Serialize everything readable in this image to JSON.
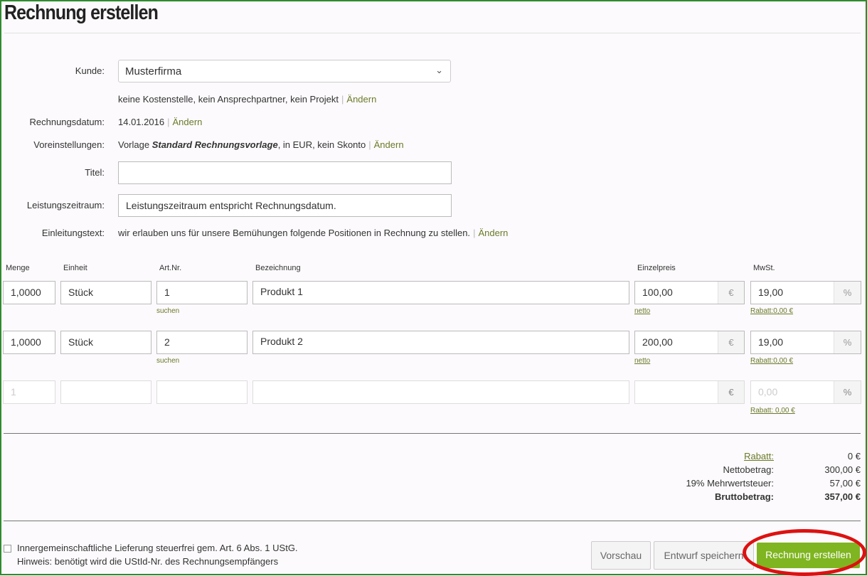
{
  "page": {
    "title": "Rechnung erstellen"
  },
  "form": {
    "kunde_label": "Kunde:",
    "kunde_value": "Musterfirma",
    "kunde_details": "keine Kostenstelle, kein Ansprechpartner, kein Projekt",
    "change_link": "Ändern",
    "datum_label": "Rechnungsdatum:",
    "datum_value": "14.01.2016",
    "voreinst_label": "Voreinstellungen:",
    "voreinst_prefix": "Vorlage ",
    "voreinst_template": "Standard Rechnungsvorlage",
    "voreinst_suffix": ", in EUR, kein Skonto",
    "titel_label": "Titel:",
    "titel_value": "",
    "leistung_label": "Leistungszeitraum:",
    "leistung_value": "Leistungszeitraum entspricht Rechnungsdatum.",
    "einleitung_label": "Einleitungstext:",
    "einleitung_value": "wir erlauben uns für unsere Bemühungen folgende Positionen in Rechnung zu stellen."
  },
  "table": {
    "headers": {
      "menge": "Menge",
      "einheit": "Einheit",
      "artnr": "Art.Nr.",
      "bezeichnung": "Bezeichnung",
      "einzelpreis": "Einzelpreis",
      "mwst": "MwSt."
    },
    "currency_symbol": "€",
    "percent_symbol": "%",
    "search_link": "suchen",
    "netto_link": "netto",
    "rows": [
      {
        "menge": "1,0000",
        "einheit": "Stück",
        "artnr": "1",
        "bezeichnung": "Produkt 1",
        "preis": "100,00",
        "mwst": "19,00",
        "rabatt": "Rabatt:0,00 €"
      },
      {
        "menge": "1,0000",
        "einheit": "Stück",
        "artnr": "2",
        "bezeichnung": "Produkt 2",
        "preis": "200,00",
        "mwst": "19,00",
        "rabatt": "Rabatt:0,00 €"
      }
    ],
    "new_row": {
      "menge_placeholder": "1",
      "mwst_placeholder": "0,00",
      "rabatt": "Rabatt: 0,00 €"
    }
  },
  "totals": {
    "rabatt_label": "Rabatt:",
    "rabatt_value": "0 €",
    "netto_label": "Nettobetrag:",
    "netto_value": "300,00 €",
    "mwst_label": "19% Mehrwertsteuer:",
    "mwst_value": "57,00 €",
    "brutto_label": "Bruttobetrag:",
    "brutto_value": "357,00 €"
  },
  "footer": {
    "checkbox_label": "Innergemeinschaftliche Lieferung steuerfrei gem. Art. 6 Abs. 1 UStG.",
    "hint": "Hinweis: benötigt wird die UStId-Nr. des Rechnungsempfängers",
    "btn_preview": "Vorschau",
    "btn_draft": "Entwurf speichern",
    "btn_create": "Rechnung erstellen"
  },
  "colors": {
    "accent": "#7fb520",
    "link": "#6b7a2a",
    "highlight": "#dd1111",
    "frame": "#2e8b2e"
  }
}
